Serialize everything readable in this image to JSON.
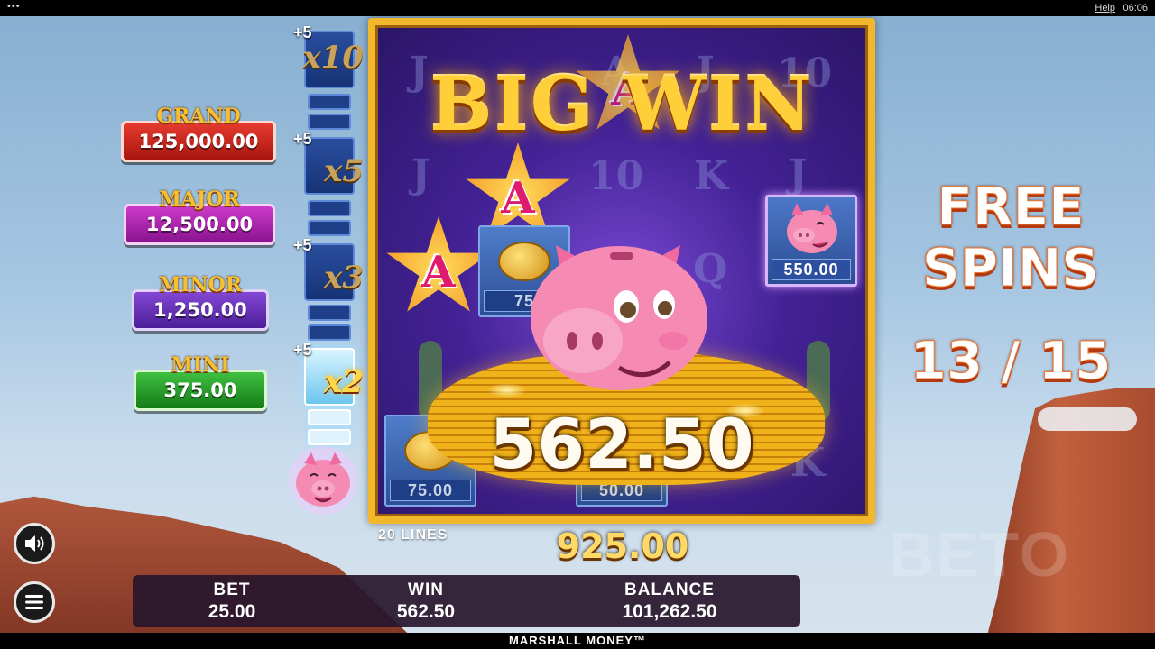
{
  "topbar": {
    "menu_dots": "•••",
    "help": "Help",
    "clock": "06:06"
  },
  "jackpots": [
    {
      "name": "GRAND",
      "value": "125,000.00"
    },
    {
      "name": "MAJOR",
      "value": "12,500.00"
    },
    {
      "name": "MINOR",
      "value": "1,250.00"
    },
    {
      "name": "MINI",
      "value": "375.00"
    }
  ],
  "meter": {
    "steps": [
      {
        "plus": "+5",
        "mult": "x10"
      },
      {
        "plus": "+5",
        "mult": "x5"
      },
      {
        "plus": "+5",
        "mult": "x3"
      },
      {
        "plus": "+5",
        "mult": "x2"
      }
    ]
  },
  "reels": {
    "symbols": [
      "J",
      "A",
      "J",
      "10",
      "J",
      "10",
      "K",
      "J",
      "Q",
      "A",
      "K",
      "A"
    ],
    "star_symbols": [
      "A",
      "A",
      "A"
    ],
    "cells": [
      {
        "value": "75",
        "kind": "coin"
      },
      {
        "value": "550.00",
        "kind": "pig"
      },
      {
        "value": "75.00",
        "kind": "coin"
      },
      {
        "value": "50.00",
        "kind": "coin"
      }
    ]
  },
  "big_win": {
    "title": "BIG WIN",
    "amount": "562.50"
  },
  "lines_label": "20 LINES",
  "total_win": "925.00",
  "free_spins": {
    "label_line1": "FREE",
    "label_line2": "SPINS",
    "count": "13 / 15"
  },
  "bar": {
    "bet_label": "BET",
    "bet_value": "25.00",
    "win_label": "WIN",
    "win_value": "562.50",
    "balance_label": "BALANCE",
    "balance_value": "101,262.50"
  },
  "watermark": "BETO",
  "footer": "MARSHALL MONEY™",
  "colors": {
    "frame_gold": "#f2b72a",
    "reel_purple": "#432295",
    "win_gold": "#ffcf3a"
  }
}
